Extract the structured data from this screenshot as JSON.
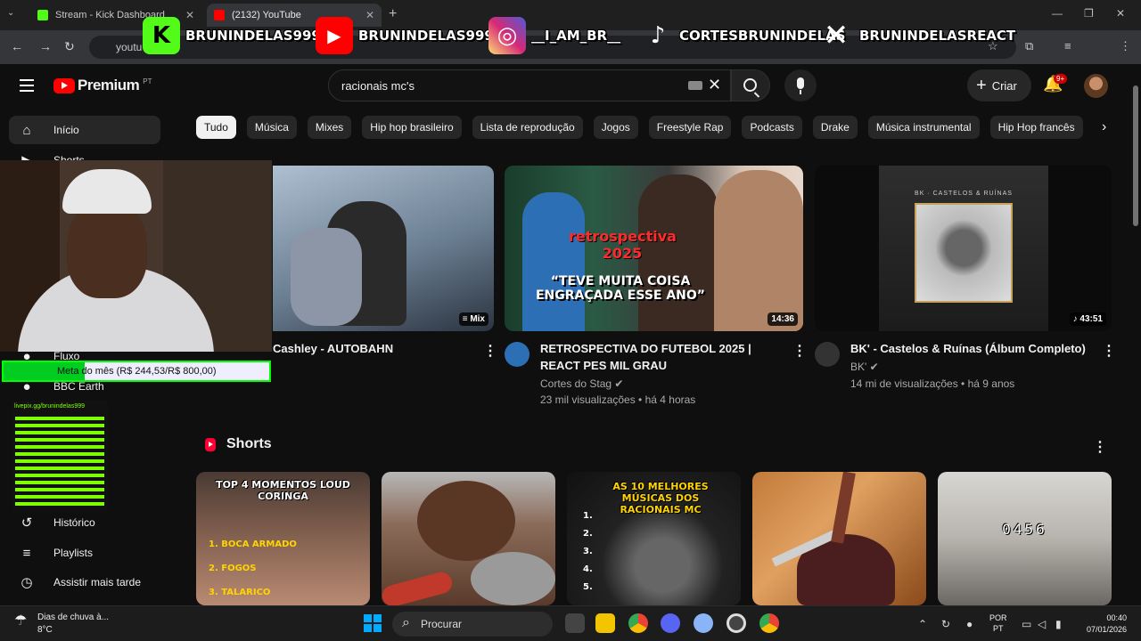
{
  "browser": {
    "tabs": [
      {
        "title": "Stream - Kick Dashboard",
        "favicon_color": "#53fc18"
      },
      {
        "title": "(2132) YouTube",
        "favicon_color": "#ff0000"
      }
    ],
    "address": "youtu"
  },
  "social_overlay": [
    {
      "platform": "kick",
      "icon": "K",
      "handle": "BRUNINDELAS999",
      "color": "#53fc18"
    },
    {
      "platform": "youtube",
      "icon": "▶",
      "handle": "BRUNINDELAS999",
      "color": "#ff0000"
    },
    {
      "platform": "instagram",
      "icon": "◎",
      "handle": "__I_AM_BR__",
      "color": "#c13584"
    },
    {
      "platform": "tiktok",
      "icon": "♪",
      "handle": "CORTESBRUNINDELAS",
      "color": "#000000"
    },
    {
      "platform": "x",
      "icon": "✕",
      "handle": "BRUNINDELASREACT",
      "color": "#000000"
    }
  ],
  "youtube": {
    "logo": "Premium",
    "logo_country": "PT",
    "search_query": "racionais mc's",
    "create_label": "Criar",
    "notification_count": "9+",
    "chips": [
      "Tudo",
      "Música",
      "Mixes",
      "Hip hop brasileiro",
      "Lista de reprodução",
      "Jogos",
      "Freestyle Rap",
      "Podcasts",
      "Drake",
      "Música instrumental",
      "Hip Hop francês"
    ],
    "sidebar": [
      {
        "icon": "home-icon",
        "label": "Início"
      },
      {
        "icon": "shorts-icon",
        "label": "Shorts"
      },
      {
        "icon": "channel-icon",
        "label": "Fluxo"
      },
      {
        "icon": "channel-icon",
        "label": "BBC Earth"
      },
      {
        "icon": "history-icon",
        "label": "Histórico"
      },
      {
        "icon": "playlists-icon",
        "label": "Playlists"
      },
      {
        "icon": "watch-later-icon",
        "label": "Assistir mais tarde"
      }
    ],
    "videos": [
      {
        "title": "Cashley - AUTOBAHN",
        "badge": "Mix",
        "channel": "",
        "stats": ""
      },
      {
        "title": "RETROSPECTIVA DO FUTEBOL 2025 | REACT PES MIL GRAU",
        "badge": "14:36",
        "channel": "Cortes do Stag",
        "stats": "23 mil visualizações • há 4 horas",
        "thumb_text": "“TEVE MUITA COISA ENGRAÇADA ESSE ANO”",
        "thumb_year": "retrospectiva 2025"
      },
      {
        "title": "BK' - Castelos & Ruínas (Álbum Completo)",
        "badge": "43:51",
        "channel": "BK'",
        "stats": "14 mi de visualizações • há 9 anos",
        "thumb_text": "BK · CASTELOS & RUÍNAS"
      }
    ],
    "shorts_title": "Shorts",
    "shorts": [
      {
        "caption": "TOP 4 MOMENTOS LOUD CORINGA",
        "list": [
          "BOCA ARMADO",
          "FOGOS",
          "TALARICO"
        ]
      },
      {
        "caption": ""
      },
      {
        "caption": "AS 10 MELHORES MÚSICAS DOS RACIONAIS MC",
        "list": [
          "1.",
          "2.",
          "3.",
          "4.",
          "5."
        ]
      },
      {
        "caption": ""
      },
      {
        "caption": "0456"
      }
    ]
  },
  "stream_overlay": {
    "goal_text": "Meta do mês (R$ 244,53/R$ 800,00)",
    "goal_progress": 0.306,
    "qr_label": "livepix.gg/brunindelas999"
  },
  "taskbar": {
    "weather_title": "Dias de chuva à...",
    "weather_temp": "8°C",
    "search_label": "Procurar",
    "lang1": "POR",
    "lang2": "PT",
    "time": "00:40",
    "date": "07/01/2026"
  }
}
